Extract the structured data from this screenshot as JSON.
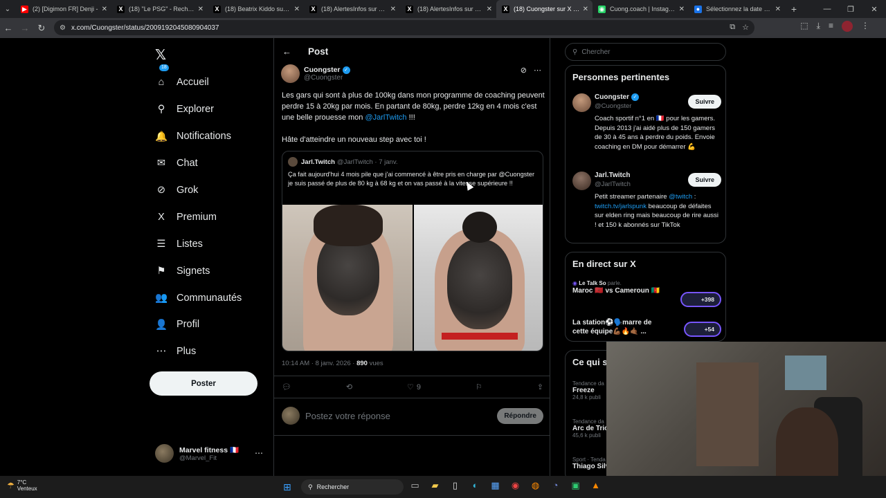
{
  "browser": {
    "tabs": [
      {
        "title": "(2) [Digimon FR] Denji - ",
        "fav_color": "#ff0000",
        "fav": "▶"
      },
      {
        "title": "(18) \"Le PSG\" - Recherche",
        "fav_color": "#000000",
        "fav": "X"
      },
      {
        "title": "(18) Beatrix Kiddo sur X :",
        "fav_color": "#000000",
        "fav": "X"
      },
      {
        "title": "(18) AlertesInfos sur X : \"",
        "fav_color": "#000000",
        "fav": "X"
      },
      {
        "title": "(18) AlertesInfos sur X : \"",
        "fav_color": "#000000",
        "fav": "X"
      },
      {
        "title": "(18) Cuongster sur X : \"Le",
        "fav_color": "#000000",
        "fav": "X"
      },
      {
        "title": "Cuong.coach | Instagram",
        "fav_color": "#25d366",
        "fav": "◉"
      },
      {
        "title": "Sélectionnez la date et l'h",
        "fav_color": "#1a73e8",
        "fav": "●"
      }
    ],
    "url": "x.com/Cuongster/status/2009192045080904037"
  },
  "nav": {
    "items": [
      {
        "label": "Accueil",
        "icon": "⌂"
      },
      {
        "label": "Explorer",
        "icon": "⚲"
      },
      {
        "label": "Notifications",
        "icon": "🔔",
        "badge": "18"
      },
      {
        "label": "Chat",
        "icon": "✉"
      },
      {
        "label": "Grok",
        "icon": "⊘"
      },
      {
        "label": "Premium",
        "icon": "X"
      },
      {
        "label": "Listes",
        "icon": "☰"
      },
      {
        "label": "Signets",
        "icon": "⚑"
      },
      {
        "label": "Communautés",
        "icon": "👥"
      },
      {
        "label": "Profil",
        "icon": "👤"
      },
      {
        "label": "Plus",
        "icon": "⋯"
      }
    ],
    "post_button": "Poster",
    "account": {
      "name": "Marvel fitness 🇫🇷",
      "handle": "@Marvel_Fit"
    }
  },
  "post": {
    "header": "Post",
    "author_name": "Cuongster",
    "author_handle": "@Cuongster",
    "text_main": "Les gars qui sont à plus de 100kg dans mon programme de coaching peuvent perdre 15 à 20kg par mois. En partant de 80kg, perdre 12kg en 4 mois c'est une belle prouesse mon ",
    "mention": "@JarlTwitch",
    "text_after_mention": " !!!",
    "text_second": "Hâte d'atteindre un nouveau step avec toi !",
    "quote": {
      "name": "Jarl.Twitch",
      "handle": "@JarlTwitch · 7 janv.",
      "text": "Ça fait aujourd'hui 4 mois pile que j'ai commencé à être pris en charge par @Cuongster je suis passé de plus de 80 kg à 68 kg et on vas passé à la vitesse supérieure !!"
    },
    "meta_time": "10:14 AM · 8 janv. 2026 · ",
    "meta_views_count": "890",
    "meta_views_label": " vues",
    "likes": "9",
    "reply_placeholder": "Postez votre réponse",
    "reply_button": "Répondre"
  },
  "right": {
    "search_placeholder": "Chercher",
    "relevant_title": "Personnes pertinentes",
    "people": [
      {
        "name": "Cuongster",
        "handle": "@Cuongster",
        "follow": "Suivre",
        "bio": "Coach sportif n°1 en 🇫🇷 pour les gamers. Depuis 2013 j'ai aidé plus de 150 gamers de 30 à 45 ans à perdre du poids. Envoie coaching en DM pour démarrer 💪"
      },
      {
        "name": "Jarl.Twitch",
        "handle": "@JarlTwitch",
        "follow": "Suivre",
        "bio_prefix": "Petit streamer partenaire ",
        "bio_link1": "@twitch",
        "bio_mid": " : ",
        "bio_link2": "twitch.tv/jarlspunk",
        "bio_suffix": " beaucoup de défaites sur elden ring mais beaucoup de rire aussi ! et 150 k abonnés sur TikTok"
      }
    ],
    "live_title": "En direct sur X",
    "live": [
      {
        "host": "Le Talk So",
        "host_suffix": " parle.",
        "title": "Maroc 🇲🇦 vs Cameroun 🇨🇲",
        "count": "+398"
      },
      {
        "title": "La station⚽🗣️marre de cette équipe💪🏾🔥🤙🏾 ...",
        "count": "+54"
      }
    ],
    "trends_title": "Ce qui s",
    "trends": [
      {
        "category": "Tendance da",
        "name": "Freeze",
        "count": "24,8 k publi"
      },
      {
        "category": "Tendance da",
        "name": "Arc de Tric",
        "count": "45,6 k publi"
      },
      {
        "category": "Sport · Tenda",
        "name": "Thiago Silv",
        "count": ""
      }
    ]
  },
  "taskbar": {
    "temp": "7°C",
    "weather": "Venteux",
    "search": "Rechercher"
  }
}
